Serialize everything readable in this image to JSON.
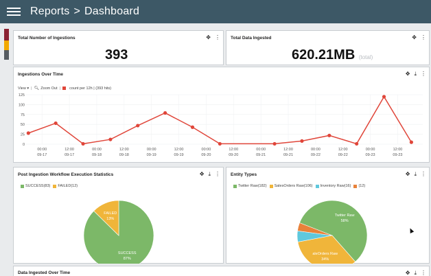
{
  "header": {
    "breadcrumb": [
      "Reports",
      "Dashboard"
    ],
    "separator": ">"
  },
  "sidebar": {
    "colors": [
      "#8b2232",
      "#f2a900",
      "#555b60"
    ]
  },
  "panels": {
    "ingestions": {
      "title": "Total Number of Ingestions",
      "value": "393"
    },
    "data_ingested": {
      "title": "Total Data Ingested",
      "value": "620.21MB",
      "suffix": "(total)"
    },
    "over_time": {
      "title": "Ingestions Over Time",
      "view_label": "View",
      "zoom_label": "Zoom Out",
      "legend": "count per 12h | (393 hits)"
    },
    "workflow": {
      "title": "Post Ingestion Workflow Execution Statistics"
    },
    "entity": {
      "title": "Entity Types"
    },
    "data_over_time": {
      "title": "Data Ingested Over Time"
    }
  },
  "icons": {
    "move": "move-icon",
    "download": "download-icon",
    "more": "more-vert-icon",
    "menu": "menu-icon",
    "search": "search-icon"
  },
  "colors": {
    "accent": "#3d5866",
    "line": "#e0463a",
    "green": "#7cb868",
    "amber": "#f0b53a",
    "cyan": "#5fc8dd",
    "orange": "#e8823a"
  },
  "chart_data": [
    {
      "type": "line",
      "title": "Ingestions Over Time",
      "x_ticks": [
        [
          "00:00",
          "09-17"
        ],
        [
          "12:00",
          "09-17"
        ],
        [
          "00:00",
          "09-18"
        ],
        [
          "12:00",
          "09-18"
        ],
        [
          "00:00",
          "09-19"
        ],
        [
          "12:00",
          "09-19"
        ],
        [
          "00:00",
          "09-20"
        ],
        [
          "12:00",
          "09-20"
        ],
        [
          "00:00",
          "09-21"
        ],
        [
          "12:00",
          "09-21"
        ],
        [
          "00:00",
          "09-22"
        ],
        [
          "12:00",
          "09-22"
        ],
        [
          "00:00",
          "09-23"
        ],
        [
          "12:00",
          "09-23"
        ]
      ],
      "y_ticks": [
        "125",
        "100",
        "75",
        "50",
        "25",
        "0"
      ],
      "ylim": [
        0,
        125
      ],
      "points": [
        {
          "x": "09-16 18:00",
          "y": 28
        },
        {
          "x": "09-17 06:00",
          "y": 53
        },
        {
          "x": "09-17 18:00",
          "y": 1
        },
        {
          "x": "09-18 06:00",
          "y": 12
        },
        {
          "x": "09-18 18:00",
          "y": 47
        },
        {
          "x": "09-19 06:00",
          "y": 79
        },
        {
          "x": "09-19 18:00",
          "y": 43
        },
        {
          "x": "09-20 06:00",
          "y": 1
        },
        {
          "x": "09-21 06:00",
          "y": 1
        },
        {
          "x": "09-21 18:00",
          "y": 8
        },
        {
          "x": "09-22 06:00",
          "y": 22
        },
        {
          "x": "09-22 18:00",
          "y": 1
        },
        {
          "x": "09-23 06:00",
          "y": 120
        },
        {
          "x": "09-23 18:00",
          "y": 5
        }
      ]
    },
    {
      "type": "pie",
      "title": "Post Ingestion Workflow Execution Statistics",
      "slices": [
        {
          "name": "SUCCESS",
          "legend": "SUCCESS(83)",
          "value": 83,
          "label_name": "SUCCESS",
          "label_pct": "87%",
          "color": "#7cb868"
        },
        {
          "name": "FAILED",
          "legend": "FAILED(12)",
          "value": 12,
          "label_name": "FAILED",
          "label_pct": "13%",
          "color": "#f0b53a"
        }
      ]
    },
    {
      "type": "pie",
      "title": "Entity Types",
      "slices": [
        {
          "name": "Twitter Raw",
          "legend": "Twitter Raw(182)",
          "value": 182,
          "label_name": "Twitter Raw",
          "label_pct": "58%",
          "color": "#7cb868"
        },
        {
          "name": "SalesOrders Raw",
          "legend": "SalesOrders Raw(106)",
          "value": 106,
          "label_name": "aleOrders Raw",
          "label_pct": "34%",
          "color": "#f0b53a"
        },
        {
          "name": "Inventory Raw",
          "legend": "Inventory Raw(16)",
          "value": 16,
          "label_name": "",
          "label_pct": "",
          "color": "#5fc8dd"
        },
        {
          "name": "",
          "legend": "(12)",
          "value": 12,
          "label_name": "",
          "label_pct": "",
          "color": "#e8823a"
        }
      ]
    }
  ]
}
